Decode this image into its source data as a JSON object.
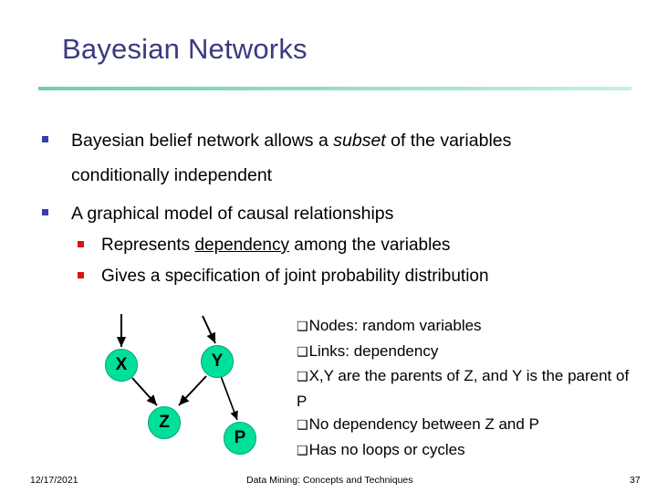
{
  "slide": {
    "title": "Bayesian Networks",
    "accent_color": "#3a3a80",
    "rule_color_left": "#6ecfb0",
    "rule_color_right": "#c8efe6",
    "node_fill": "#00e09a",
    "node_stroke": "#00a477",
    "bullet_color_level1": "#3b3bb0",
    "bullet_color_level2": "#e01010"
  },
  "bullets": {
    "b1_part1": "Bayesian belief network allows a ",
    "b1_italic": "subset",
    "b1_part2": " of the variables",
    "b1_line2": "conditionally independent",
    "b2": "A graphical model of causal relationships",
    "s1_part1": "Represents ",
    "s1_underline": "dependency",
    "s1_part2": " among the variables",
    "s2": "Gives a specification of joint probability distribution"
  },
  "diagram": {
    "nodes": [
      {
        "id": "X",
        "label": "X"
      },
      {
        "id": "Y",
        "label": "Y"
      },
      {
        "id": "Z",
        "label": "Z"
      },
      {
        "id": "P",
        "label": "P"
      }
    ],
    "edges": [
      {
        "from": "external",
        "to": "X"
      },
      {
        "from": "external",
        "to": "Y"
      },
      {
        "from": "X",
        "to": "Z"
      },
      {
        "from": "Y",
        "to": "Z"
      },
      {
        "from": "Y",
        "to": "P"
      }
    ]
  },
  "notes": {
    "bullet_glyph": "❑",
    "lines": [
      "Nodes: random variables",
      "Links: dependency",
      "X,Y are the parents of Z, and Y is the parent of P",
      "No dependency between Z and P",
      "Has no loops or cycles"
    ]
  },
  "footer": {
    "date": "12/17/2021",
    "center": "Data Mining: Concepts and Techniques",
    "page": "37"
  }
}
